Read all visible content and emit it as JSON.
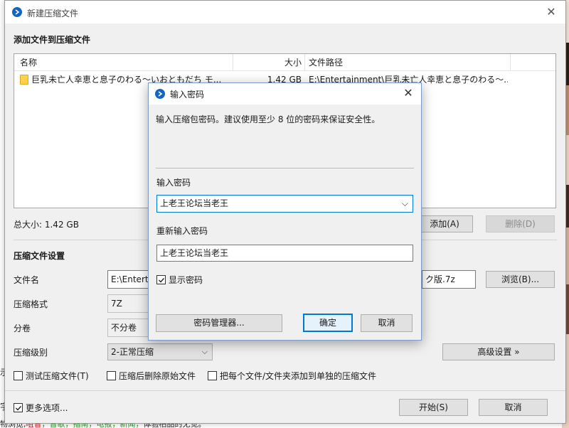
{
  "main_window": {
    "title": "新建压缩文件",
    "close_glyph": "✕",
    "add_section_title": "添加文件到压缩文件",
    "file_list": {
      "columns": [
        "名称",
        "大小",
        "文件路径"
      ],
      "rows": [
        {
          "name": "巨乳未亡人幸恵と息子のわる～いおともだち モ...",
          "size": "1.42 GB",
          "path": "E:\\Entertainment\\巨乳未亡人幸恵と息子のわる～..."
        }
      ]
    },
    "total_size": "总大小: 1.42 GB",
    "add_button": "添加(A)",
    "delete_button": "删除(D)",
    "settings_title": "压缩文件设置",
    "filename_label": "文件名",
    "filename_value": "E:\\Entert",
    "filename_tail": "ク版.7z",
    "browse_button": "浏览(B)...",
    "format_label": "压缩格式",
    "format_value": "7Z",
    "split_label": "分卷",
    "split_value": "不分卷",
    "level_label": "压缩级别",
    "level_value": "2-正常压缩",
    "advanced_button": "高级设置 »",
    "options": [
      {
        "label": "测试压缩文件(T)",
        "checked": false
      },
      {
        "label": "压缩后删除原始文件",
        "checked": false
      },
      {
        "label": "把每个文件/文件夹添加到单独的压缩文件",
        "checked": false
      }
    ],
    "more_options": {
      "label": "更多选项...",
      "checked": true
    },
    "start_button": "开始(S)",
    "cancel_button": "取消"
  },
  "password_dialog": {
    "title": "输入密码",
    "close_glyph": "✕",
    "note": "输入压缩包密码。建议使用至少 8 位的密码来保证安全性。",
    "password_label": "输入密码",
    "password_value": "上老王论坛当老王",
    "reenter_label": "重新输入密码",
    "reenter_value": "上老王论坛当老王",
    "show_password": {
      "label": "显示密码",
      "checked": true
    },
    "manager_button": "密码管理器...",
    "ok_button": "确定",
    "cancel_button": "取消"
  },
  "background": {
    "bottom_line_prefix": "物浏览,",
    "bottom_line_red": "咀音",
    "bottom_line_green": "，音歌，指南，电报，新闻，",
    "bottom_line_tail": "体验柏品的无觉。",
    "left_fragment_1": "示",
    "left_fragment_2": "字"
  },
  "colors": {
    "accent": "#0078d7",
    "app_icon": "#1565c0",
    "link": "#1664c8"
  }
}
